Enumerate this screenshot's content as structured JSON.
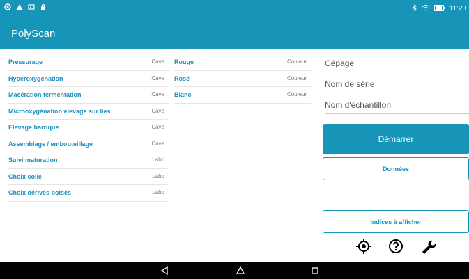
{
  "status_bar": {
    "left_icons": [
      "navigation-icon",
      "warning-icon",
      "image-icon",
      "lock-icon"
    ],
    "right_icons": [
      "bluetooth-icon",
      "wifi-icon",
      "battery-icon"
    ],
    "time": "11:23"
  },
  "app": {
    "title": "PolyScan"
  },
  "left_list": [
    {
      "label": "Pressurage",
      "tag": "Cave"
    },
    {
      "label": "Hyperoxygénation",
      "tag": "Cave"
    },
    {
      "label": "Macération fermentation",
      "tag": "Cave"
    },
    {
      "label": "Microoxygénation élevage sur lies",
      "tag": "Cave"
    },
    {
      "label": "Elevage barrique",
      "tag": "Cave"
    },
    {
      "label": "Assemblage / embouteillage",
      "tag": "Cave"
    },
    {
      "label": "Suivi maturation",
      "tag": "Labo"
    },
    {
      "label": "Choix colle",
      "tag": "Labo"
    },
    {
      "label": "Choix dérivés boisés",
      "tag": "Labo"
    }
  ],
  "mid_list": [
    {
      "label": "Rouge",
      "tag": "Couleur"
    },
    {
      "label": "Rosé",
      "tag": "Couleur"
    },
    {
      "label": "Blanc",
      "tag": "Couleur"
    }
  ],
  "form": {
    "cepage_placeholder": "Cépage",
    "serie_placeholder": "Nom de série",
    "echantillon_placeholder": "Nom d'échantillon"
  },
  "buttons": {
    "start": "Démarrer",
    "data": "Données",
    "indices": "Indices à afficher"
  },
  "bottom_icons": [
    "location-icon",
    "help-icon",
    "wrench-icon"
  ],
  "nav": [
    "back-icon",
    "home-icon",
    "recents-icon"
  ],
  "colors": {
    "primary": "#1795b8",
    "link": "#1f8fbf",
    "navbar": "#000000"
  }
}
